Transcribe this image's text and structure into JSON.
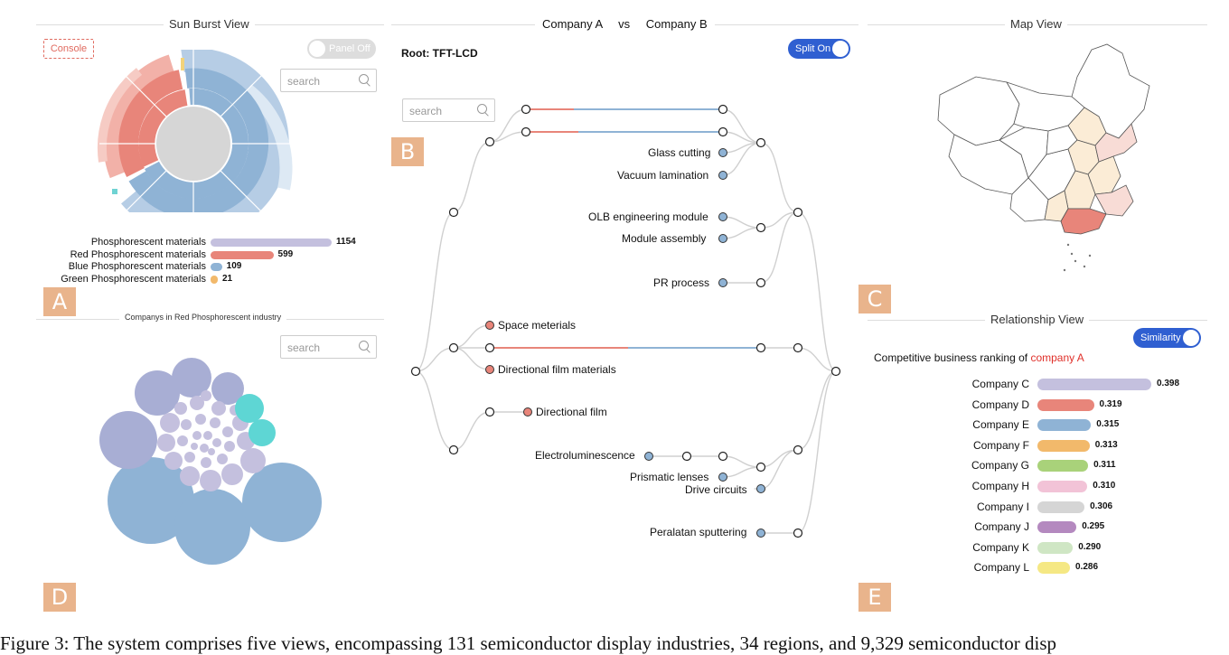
{
  "panelA": {
    "title": "Sun Burst View",
    "console_label": "Console",
    "panel_toggle": "Panel Off",
    "search_placeholder": "search",
    "badge": "A",
    "legend": [
      {
        "label": "Phosphorescent materials",
        "value": 1154,
        "value_text": "1154",
        "color": "#c4c0de"
      },
      {
        "label": "Red  Phosphorescent  materials",
        "value": 599,
        "value_text": "599",
        "color": "#e8857a"
      },
      {
        "label": "Blue Phosphorescent  materials",
        "value": 109,
        "value_text": "109",
        "color": "#8fb3d5"
      },
      {
        "label": "Green  Phosphorescent  materials",
        "value": 21,
        "value_text": "21",
        "color": "#f2b96b"
      }
    ]
  },
  "panelB": {
    "company_a": "Company A",
    "vs": "vs",
    "company_b": "Company B",
    "root_label": "Root: TFT-LCD",
    "split_toggle": "Split On",
    "search_placeholder": "search",
    "badge": "B",
    "nodes": {
      "glass_cutting": "Glass cutting",
      "vacuum_lamination": "Vacuum lamination",
      "olb": "OLB engineering module",
      "module_assembly": "Module  assembly",
      "pr_process": "PR  process",
      "space_materials": "Space meterials",
      "directional_film_materials": "Directional film materials",
      "directional_film": "Directional film",
      "electroluminescence": "Electroluminescence",
      "prismatic_lenses": "Prismatic lenses",
      "drive_circuits": "Drive circuits",
      "peralatan_sputtering": "Peralatan sputtering"
    }
  },
  "panelC": {
    "title": "Map View",
    "badge": "C"
  },
  "panelD": {
    "title": "Companys in Red Phosphorescent industry",
    "search_placeholder": "search",
    "badge": "D"
  },
  "panelE": {
    "title": "Relationship View",
    "similarity_toggle": "Similarity",
    "heading_prefix": "Competitive  business  ranking  of",
    "heading_company": "company  A",
    "badge": "E",
    "max_value": 0.4,
    "ranking": [
      {
        "company": "Company C",
        "value": 0.398,
        "value_text": "0.398",
        "color": "#c4c0de"
      },
      {
        "company": "Company D",
        "value": 0.319,
        "value_text": "0.319",
        "color": "#e8857a"
      },
      {
        "company": "Company E",
        "value": 0.315,
        "value_text": "0.315",
        "color": "#8fb3d5"
      },
      {
        "company": "Company F",
        "value": 0.313,
        "value_text": "0.313",
        "color": "#f2b96b"
      },
      {
        "company": "Company G",
        "value": 0.311,
        "value_text": "0.311",
        "color": "#a9d27a"
      },
      {
        "company": "Company H",
        "value": 0.31,
        "value_text": "0.310",
        "color": "#f2c3d7"
      },
      {
        "company": "Company I",
        "value": 0.306,
        "value_text": "0.306",
        "color": "#d5d5d5"
      },
      {
        "company": "Company J",
        "value": 0.295,
        "value_text": "0.295",
        "color": "#b489bf"
      },
      {
        "company": "Company K",
        "value": 0.29,
        "value_text": "0.290",
        "color": "#cfe6c4"
      },
      {
        "company": "Company L",
        "value": 0.286,
        "value_text": "0.286",
        "color": "#f5e884"
      }
    ]
  },
  "caption": "Figure 3: The system comprises five views, encompassing 131 semiconductor display industries, 34 regions, and 9,329 semiconductor disp"
}
